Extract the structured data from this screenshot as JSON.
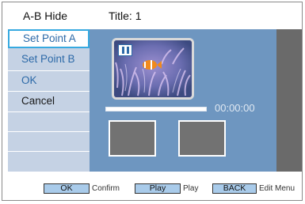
{
  "header": {
    "mode_label": "A-B Hide",
    "title_label": "Title: 1"
  },
  "menu": {
    "items": [
      {
        "label": "Set Point A",
        "selected": true
      },
      {
        "label": "Set Point B"
      },
      {
        "label": "OK"
      },
      {
        "label": "Cancel"
      }
    ]
  },
  "player": {
    "time": "00:00:00",
    "progress_fraction": 0.0,
    "state_icon": "pause-icon"
  },
  "footer": {
    "keys": [
      {
        "key": "OK",
        "label": "Confirm"
      },
      {
        "key": "Play",
        "label": "Play"
      },
      {
        "key": "BACK",
        "label": "Edit Menu"
      }
    ]
  },
  "colors": {
    "menu_bg": "#c5d2e4",
    "panel_bg": "#6e96c0",
    "selection_border": "#36a9e0",
    "key_bg": "#a9cbea"
  }
}
